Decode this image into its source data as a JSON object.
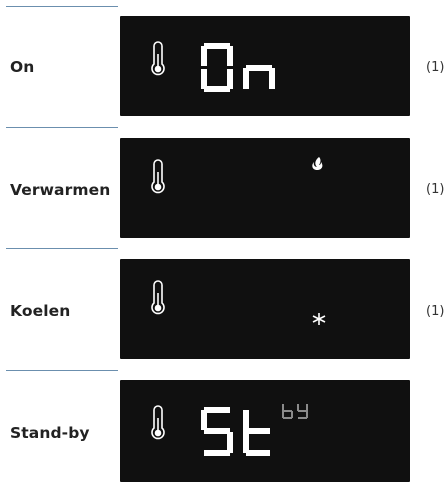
{
  "rows": [
    {
      "label": "On",
      "display_text": "On",
      "note": "(1)",
      "icon": "thermometer-icon"
    },
    {
      "label": "Verwarmen",
      "note": "(1)",
      "icon": "thermometer-icon",
      "indicator": "flame-icon"
    },
    {
      "label": "Koelen",
      "note": "(1)",
      "icon": "thermometer-icon",
      "indicator": "snowflake-icon"
    },
    {
      "label": "Stand-by",
      "display_text": "St",
      "display_subtext": "bY",
      "icon": "thermometer-icon"
    }
  ]
}
